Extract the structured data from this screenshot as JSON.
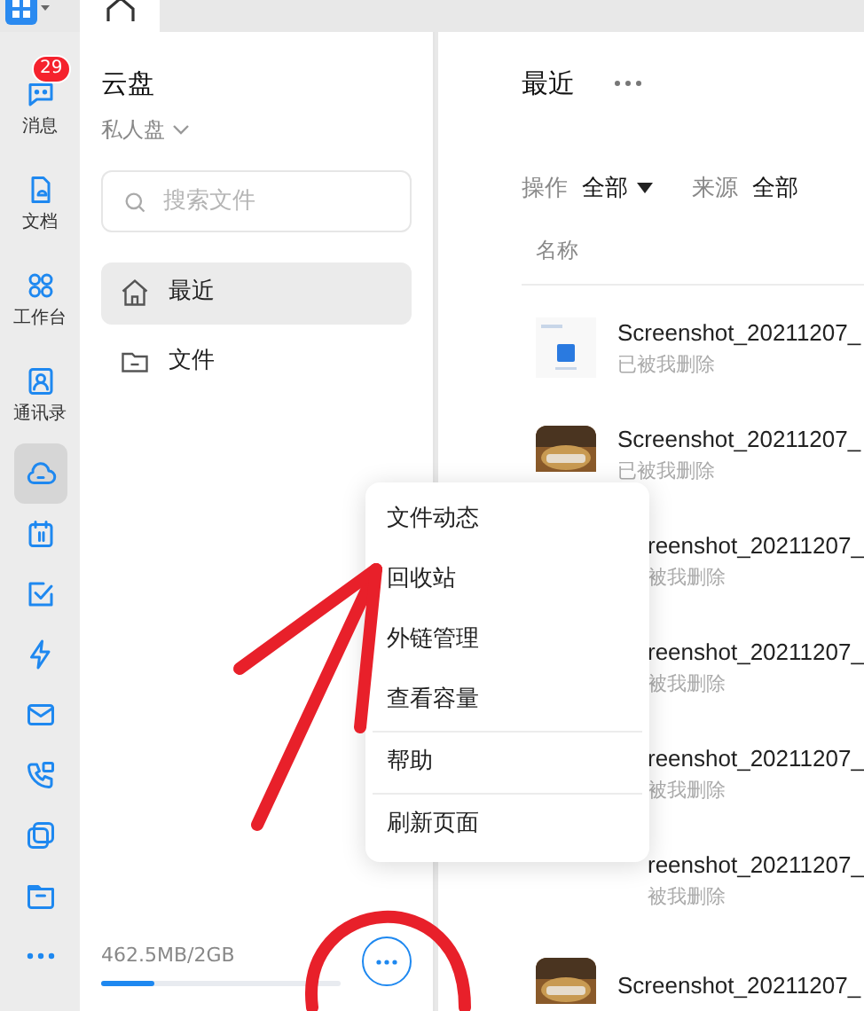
{
  "rail": {
    "items": [
      {
        "kind": "chat",
        "label": "消息",
        "badge": "29",
        "selected": false
      },
      {
        "kind": "doc",
        "label": "文档",
        "selected": false
      },
      {
        "kind": "apps",
        "label": "工作台",
        "selected": false
      },
      {
        "kind": "contacts",
        "label": "通讯录",
        "selected": false
      },
      {
        "kind": "cloud",
        "selected": true
      },
      {
        "kind": "calendar",
        "selected": false
      },
      {
        "kind": "task",
        "selected": false
      },
      {
        "kind": "bolt",
        "selected": false
      },
      {
        "kind": "mail",
        "selected": false
      },
      {
        "kind": "phone",
        "selected": false
      },
      {
        "kind": "note",
        "selected": false
      },
      {
        "kind": "folder",
        "selected": false
      },
      {
        "kind": "more",
        "selected": false
      }
    ]
  },
  "sidebar": {
    "title": "云盘",
    "drive": "私人盘",
    "search": {
      "placeholder": "搜索文件"
    },
    "items": [
      {
        "kind": "home",
        "label": "最近",
        "selected": true
      },
      {
        "kind": "folder",
        "label": "文件",
        "selected": false
      }
    ],
    "storage": {
      "text": "462.5MB/2GB",
      "level": 0.22
    }
  },
  "main": {
    "title": "最近",
    "filters": [
      {
        "label": "操作",
        "value": "全部",
        "dropdown": true
      },
      {
        "label": "来源",
        "value": "全部",
        "dropdown": false
      }
    ],
    "column": "名称",
    "rows": [
      {
        "name": "Screenshot_20211207_",
        "status": "已被我删除",
        "kind": "document",
        "covered": false
      },
      {
        "name": "Screenshot_20211207_",
        "status": "已被我删除",
        "covered": false
      },
      {
        "name": "reenshot_20211207_",
        "status": "被我删除",
        "covered": true
      },
      {
        "name": "reenshot_20211207_",
        "status": "被我删除",
        "covered": true
      },
      {
        "name": "reenshot_20211207_",
        "status": "被我删除",
        "covered": true
      },
      {
        "name": "reenshot_20211207_",
        "status": "被我删除",
        "covered": true
      },
      {
        "name": "Screenshot_20211207_",
        "covered": false
      }
    ]
  },
  "menu": {
    "groups": [
      [
        "文件动态",
        "回收站",
        "外链管理",
        "查看容量"
      ],
      [
        "帮助"
      ],
      [
        "刷新页面"
      ]
    ]
  }
}
